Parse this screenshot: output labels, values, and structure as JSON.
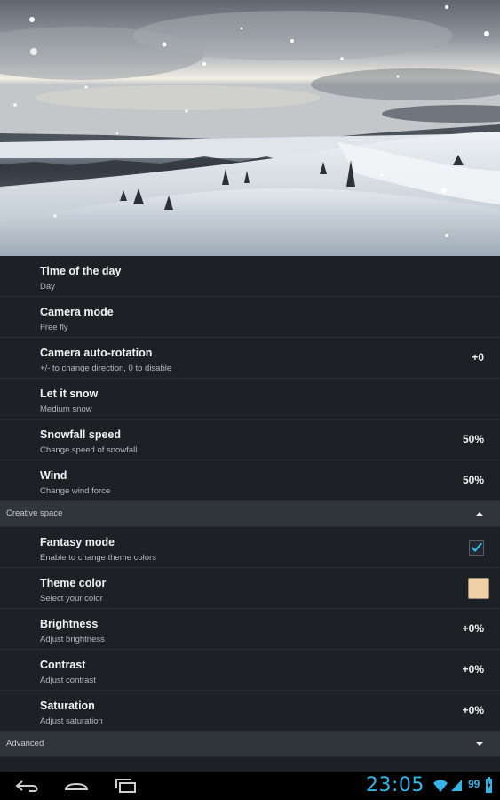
{
  "settings": [
    {
      "title": "Time of the day",
      "subtitle": "Day",
      "value": ""
    },
    {
      "title": "Camera mode",
      "subtitle": "Free fly",
      "value": ""
    },
    {
      "title": "Camera auto-rotation",
      "subtitle": "+/- to change direction, 0 to disable",
      "value": "+0"
    },
    {
      "title": "Let it snow",
      "subtitle": "Medium snow",
      "value": ""
    },
    {
      "title": "Snowfall speed",
      "subtitle": "Change speed of snowfall",
      "value": "50%"
    },
    {
      "title": "Wind",
      "subtitle": "Change wind force",
      "value": "50%"
    }
  ],
  "creative": {
    "header": "Creative space",
    "fantasy": {
      "title": "Fantasy mode",
      "subtitle": "Enable to change theme colors",
      "checked": true
    },
    "theme": {
      "title": "Theme color",
      "subtitle": "Select your color",
      "color": "#f2d0a6"
    },
    "brightness": {
      "title": "Brightness",
      "subtitle": "Adjust brightness",
      "value": "+0%"
    },
    "contrast": {
      "title": "Contrast",
      "subtitle": "Adjust contrast",
      "value": "+0%"
    },
    "saturation": {
      "title": "Saturation",
      "subtitle": "Adjust saturation",
      "value": "+0%"
    }
  },
  "advanced": {
    "header": "Advanced"
  },
  "status": {
    "time": "23:05",
    "battery": "99"
  },
  "colors": {
    "accent": "#33b5e5",
    "checkmark": "#33b5e5"
  }
}
